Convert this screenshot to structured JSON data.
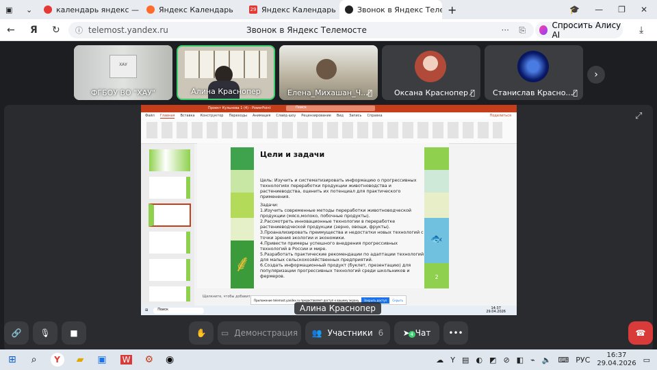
{
  "browser": {
    "tabs": [
      {
        "title": "календарь яндекс — Янд",
        "color": "#e53935",
        "active": false
      },
      {
        "title": "Яндекс Календарь",
        "color": "#ff6b2b",
        "active": false
      },
      {
        "title": "Яндекс Календарь",
        "color": "#e53935",
        "active": false,
        "badge": "29"
      },
      {
        "title": "Звонок в Яндекс Теле",
        "color": "#222222",
        "active": true
      }
    ],
    "url": "telemost.yandex.ru",
    "page_title": "Звонок в Яндекс Телемосте",
    "alice": "Спросить Алису AI"
  },
  "participants": [
    {
      "name": "ФГБОУ ВО \"ХАУ\"",
      "muted": false,
      "bg": "#c9cbc9"
    },
    {
      "name": "Алина Красноперу",
      "display": "Алина Краснопер",
      "muted": false,
      "bg": "#c8c2b6"
    },
    {
      "name": "Елена_Михашан_Ч...",
      "muted": true,
      "bg": "#c9c3b4"
    },
    {
      "name": "Оксана Краснопер",
      "muted": true,
      "bg": "#3c3d40"
    },
    {
      "name": "Станислав Красно...",
      "muted": true,
      "bg": "#3c3d40"
    }
  ],
  "speaker_label": "Алина Краснопер",
  "ppt": {
    "file_title": "Проект Кульнева 1 (4) - PowerPoint",
    "search": "Поиск",
    "menu": [
      "Файл",
      "Главная",
      "Вставка",
      "Конструктор",
      "Переходы",
      "Анимация",
      "Слайд-шоу",
      "Рецензирование",
      "Вид",
      "Запись",
      "Справка"
    ],
    "share_btn": "Поделиться",
    "slide_title": "Цели и задачи",
    "goal": "Цель: Изучить и систематизировать информацию о прогрессивных технологиях переработки продукции животноводства и растениеводства, оценить их потенциал для практического применения.",
    "tasks_head": "Задачи:",
    "tasks": [
      "1.Изучить современные методы переработки животноводческой продукции (мясо,молоко, побочные продукты).",
      "2.Рассмотреть инновационные технологии в переработке растениеводческой продукции (зерно, овощи, фрукты).",
      "3.Проанализировать преимущества и недостатки новых технологий с точки зрения экологии и экономики.",
      "4.Привести примеры успешного внедрения прогрессивных технологий в России и мире.",
      "5.Разработать практические рекомендации по адаптации технологий для малых сельскохозяйственных предприятий.",
      "6.Создать информационный продукт (буклет, презентацию) для популяризации прогрессивных технологий среди школьников и фермеров."
    ],
    "slide_number": "2",
    "notes": "Щелкните, чтобы добавить за",
    "popup_text": "Приложение telemost.yandex.ru предоставляет доступ к вашему экрану.",
    "popup_btn": "Закрыть доступ",
    "popup_hide": "Скрыть",
    "inner_time": "14:37",
    "inner_date": "29.04.2026",
    "inner_search": "Поиск"
  },
  "controls": {
    "demo": "Демонстрация",
    "participants": "Участники",
    "participants_count": "6",
    "chat": "Чат",
    "chat_badge": "4"
  },
  "taskbar": {
    "lang": "РУС",
    "time": "16:37",
    "date": "29.04.2026"
  }
}
